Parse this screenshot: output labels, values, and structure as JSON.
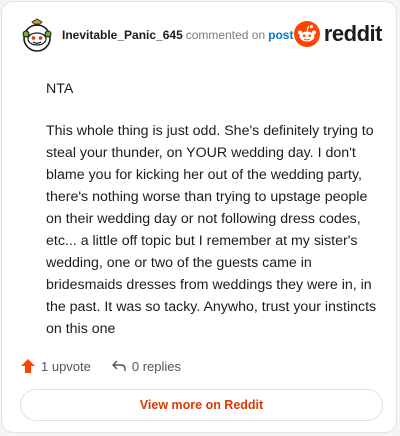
{
  "header": {
    "username": "Inevitable_Panic_645",
    "action_text": "commented on",
    "post_link": "post",
    "logo_text": "reddit"
  },
  "comment": {
    "paragraphs": [
      "NTA",
      "This whole thing is just odd. She's definitely trying to steal your thunder, on YOUR wedding day. I don't blame you for kicking her out of the wedding party, there's nothing worse than trying to upstage people on their wedding day or not following dress codes, etc... a little off topic but I remember at my sister's wedding, one or two of the guests came in bridesmaids dresses from weddings they were in, in the past. It was so tacky. Anywho, trust your instincts on this one"
    ]
  },
  "actions": {
    "upvote_label": "1 upvote",
    "replies_label": "0 replies"
  },
  "footer": {
    "button_label": "View more on Reddit"
  },
  "colors": {
    "accent": "#ff4500",
    "link": "#0079d3",
    "button_text": "#d93a00"
  },
  "icons": [
    "snoo-avatar-icon",
    "reddit-logo-icon",
    "upvote-arrow-icon",
    "reply-arrow-icon"
  ]
}
